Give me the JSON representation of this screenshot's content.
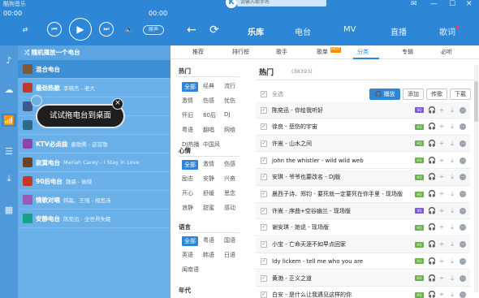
{
  "player": {
    "title": "酷狗音乐",
    "time_left": "00:00",
    "time_right": "00:00",
    "eq_label": "原声",
    "list_header": "随机播放一个电台",
    "channels": [
      {
        "name": "混合电台",
        "artist": "",
        "thumb": "#7a5c3a"
      },
      {
        "name": "最劲热歌",
        "artist": "李晓杰 - 老大",
        "thumb": "#c0392b"
      },
      {
        "name": "",
        "artist": "",
        "thumb": "#3b5b8a"
      },
      {
        "name": "",
        "artist": "",
        "thumb": "#2c6b8a"
      },
      {
        "name": "KTV必点曲",
        "artist": "秦歌腾 - 这首歌",
        "thumb": "#8e44ad"
      },
      {
        "name": "寂寞电台",
        "artist": "Mariah Carey - I Stay In Love",
        "thumb": "#6b4226"
      },
      {
        "name": "90后电台",
        "artist": "魏晨 - 破晓",
        "thumb": "#c0392b"
      },
      {
        "name": "情歌对唱",
        "artist": "韩磊、王强 - 相思汤",
        "thumb": "#9b59b6"
      },
      {
        "name": "安静电台",
        "artist": "陈奕迅 - 全世界失眠",
        "thumb": "#16a085"
      }
    ],
    "tooltip": "试试拖电台到桌面"
  },
  "header": {
    "tabs": [
      "乐库",
      "电台",
      "MV",
      "直播",
      "歌词"
    ],
    "active_tab": "乐库",
    "search_placeholder": "请输入歌手名"
  },
  "subtabs": {
    "items": [
      "推荐",
      "排行榜",
      "歌手",
      "歌单",
      "分类",
      "专辑",
      "必听"
    ],
    "hot_label": "HOT",
    "active": "分类"
  },
  "filters": {
    "hot_title": "热门",
    "hot_items": [
      "全部",
      "经典",
      "流行",
      "激情",
      "伤感",
      "忧伤",
      "怀旧",
      "80后",
      "DJ",
      "粤语",
      "翻唱",
      "网络",
      "DJ热播",
      "中国风"
    ],
    "mood_title": "心情",
    "mood_items": [
      "全部",
      "激情",
      "伤感",
      "励志",
      "安静",
      "兴奋",
      "开心",
      "舒缓",
      "思念",
      "浪静",
      "甜蜜",
      "感动"
    ],
    "lang_title": "语言",
    "lang_items": [
      "全部",
      "粤语",
      "国语",
      "英语",
      "韩语",
      "日语",
      "闽南语"
    ],
    "era_title": "年代"
  },
  "songs": {
    "title": "热门",
    "count": "(38393)",
    "select_all": "全选",
    "play_btn": "播放",
    "add_btn": "添加",
    "upload_btn": "传歌",
    "download_btn": "下载",
    "rows": [
      {
        "name": "陈奕迅 - 你给我听好",
        "badge": "SQ",
        "badge_color": "#7c5cd6"
      },
      {
        "name": "徐良 - 悲伤的宇宙",
        "badge": "HQ",
        "badge_color": "#6ab04c"
      },
      {
        "name": "许嵩 - 山水之间",
        "badge": "HQ",
        "badge_color": "#6ab04c"
      },
      {
        "name": "john the whistler - wild wild web",
        "badge": "HQ",
        "badge_color": "#6ab04c"
      },
      {
        "name": "安琪 - 爷爷也要改名 - DJ版",
        "badge": "HQ",
        "badge_color": "#6ab04c"
      },
      {
        "name": "晨西子诗、郑钧 - 要死就一定要死在你手里 - 现场版",
        "badge": "HQ",
        "badge_color": "#6ab04c"
      },
      {
        "name": "许嵩 - 序曲+空谷幽兰 - 现场版",
        "badge": "SQ",
        "badge_color": "#7c5cd6"
      },
      {
        "name": "谢安琪 - 她说 - 现场版",
        "badge": "HQ",
        "badge_color": "#6ab04c"
      },
      {
        "name": "小宝 - 亡命天涯不如早点回家",
        "badge": "HQ",
        "badge_color": "#6ab04c"
      },
      {
        "name": "Idy lickem - tell me who you are",
        "badge": "HQ",
        "badge_color": "#6ab04c"
      },
      {
        "name": "黄渤 - 正义之道",
        "badge": "HQ",
        "badge_color": "#6ab04c"
      },
      {
        "name": "白安 - 是什么让我遇见这样的你",
        "badge": "HQ",
        "badge_color": "#6ab04c"
      }
    ]
  }
}
